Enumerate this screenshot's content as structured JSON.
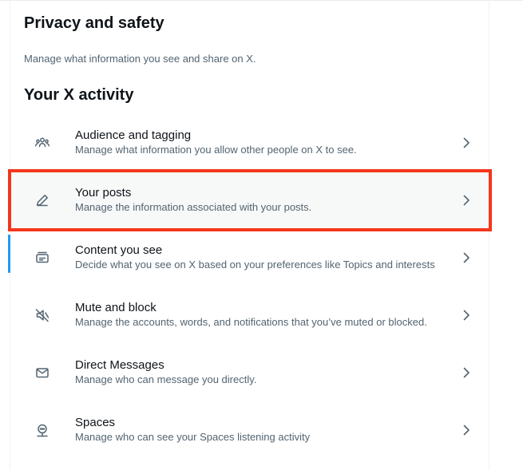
{
  "panel": {
    "title": "Privacy and safety",
    "description": "Manage what information you see and share on X."
  },
  "section": {
    "title": "Your X activity"
  },
  "items": [
    {
      "icon": "people-icon",
      "label": "Audience and tagging",
      "description": "Manage what information you allow other people on X to see."
    },
    {
      "icon": "pencil-icon",
      "label": "Your posts",
      "description": "Manage the information associated with your posts."
    },
    {
      "icon": "content-icon",
      "label": "Content you see",
      "description": "Decide what you see on X based on your preferences like Topics and interests"
    },
    {
      "icon": "mute-icon",
      "label": "Mute and block",
      "description": "Manage the accounts, words, and notifications that you’ve muted or blocked."
    },
    {
      "icon": "envelope-icon",
      "label": "Direct Messages",
      "description": "Manage who can message you directly."
    },
    {
      "icon": "microphone-icon",
      "label": "Spaces",
      "description": "Manage who can see your Spaces listening activity"
    }
  ],
  "colors": {
    "text_primary": "#0f1419",
    "text_secondary": "#536471",
    "accent": "#1d9bf0",
    "highlight_border": "#f3361b",
    "selected_bg": "#f7f9f9"
  }
}
